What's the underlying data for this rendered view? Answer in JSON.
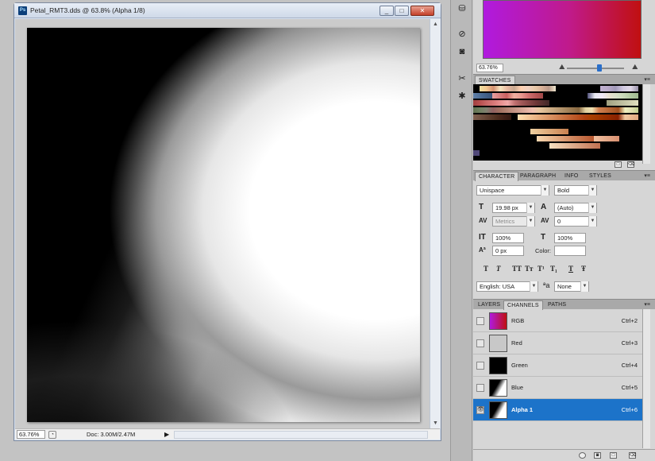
{
  "document": {
    "title": "Petal_RMT3.dds @ 63.8% (Alpha 1/8)",
    "ps_badge": "Ps",
    "min_label": "_",
    "max_label": "□",
    "close_label": "✕",
    "status": {
      "zoom": "63.76%",
      "doc_info": "Doc: 3.00M/2.47M"
    }
  },
  "color_panel": {
    "zoom": "63.76%",
    "accent": "#c01a8a"
  },
  "swatches_panel": {
    "tab": "SWATCHES"
  },
  "character_panel": {
    "tabs": [
      "CHARACTER",
      "PARAGRAPH",
      "INFO",
      "STYLES"
    ],
    "font_family": "Unispace",
    "font_style": "Bold",
    "font_size": "19.98 px",
    "leading": "(Auto)",
    "kerning": "Metrics",
    "tracking": "0",
    "vertical_scale": "100%",
    "horizontal_scale": "100%",
    "baseline_shift": "0 px",
    "color_label": "Color:",
    "style_buttons": [
      "T",
      "T",
      "TT",
      "Tт",
      "T¹",
      "T₁",
      "T",
      "Ŧ"
    ],
    "language": "English: USA",
    "anti_alias": "None",
    "aa_icon": "ªa"
  },
  "layers_panel": {
    "tabs": [
      "LAYERS",
      "CHANNELS",
      "PATHS"
    ],
    "channels": [
      {
        "name": "RGB",
        "shortcut": "Ctrl+2"
      },
      {
        "name": "Red",
        "shortcut": "Ctrl+3"
      },
      {
        "name": "Green",
        "shortcut": "Ctrl+4"
      },
      {
        "name": "Blue",
        "shortcut": "Ctrl+5"
      },
      {
        "name": "Alpha 1",
        "shortcut": "Ctrl+6"
      }
    ],
    "selected_color": "#1c73c9"
  }
}
